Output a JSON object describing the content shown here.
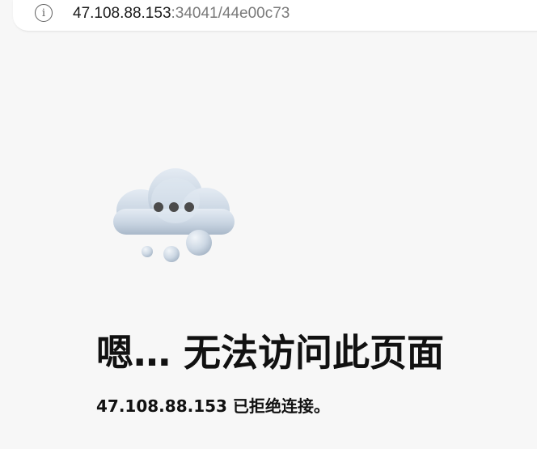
{
  "address_bar": {
    "icon": "info-icon",
    "icon_glyph": "i",
    "url_host": "47.108.88.153",
    "url_rest": ":34041/44e00c73"
  },
  "error": {
    "icon": "cloud-icon",
    "heading": "嗯… 无法访问此页面",
    "message": "47.108.88.153 已拒绝连接。"
  },
  "colors": {
    "page_background": "#f7f7f7",
    "text": "#111111",
    "url_secondary": "#7a7a7a",
    "cloud": "#c9d5e2"
  }
}
